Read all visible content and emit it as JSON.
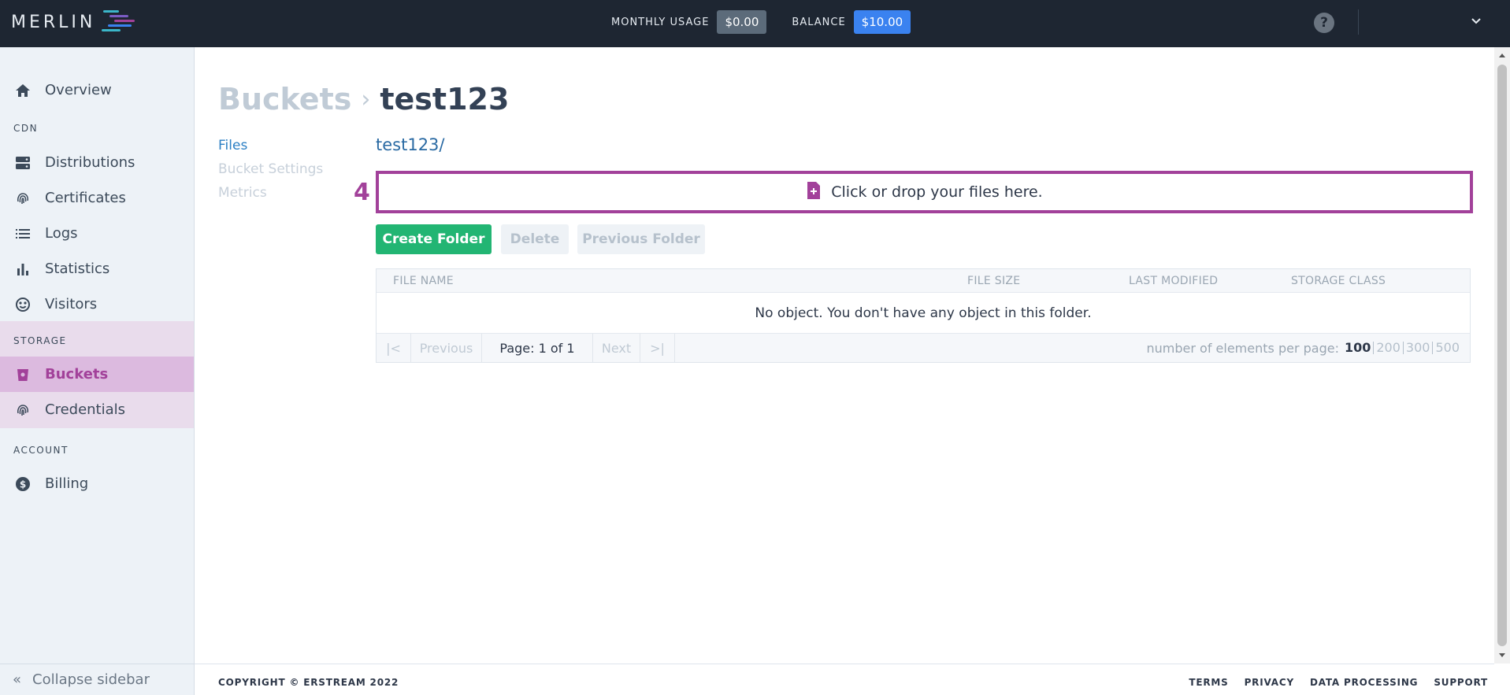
{
  "header": {
    "logo_text": "MERLIN",
    "monthly_usage_label": "MONTHLY USAGE",
    "monthly_usage_value": "$0.00",
    "balance_label": "BALANCE",
    "balance_value": "$10.00",
    "help_icon": "question-circle-icon",
    "menu_icon": "chevron-down-icon",
    "colors": {
      "bar": "#1e2632",
      "balance": "#3a82f0",
      "usage": "#5c6b7a"
    }
  },
  "sidebar": {
    "overview": "Overview",
    "cdn_heading": "CDN",
    "distributions": "Distributions",
    "certificates": "Certificates",
    "logs": "Logs",
    "statistics": "Statistics",
    "visitors": "Visitors",
    "storage_heading": "STORAGE",
    "buckets": "Buckets",
    "credentials": "Credentials",
    "account_heading": "ACCOUNT",
    "billing": "Billing",
    "collapse": "Collapse sidebar",
    "active_color": "#a2419a"
  },
  "page": {
    "breadcrumb_root": "Buckets",
    "breadcrumb_sep": "›",
    "title": "test123",
    "subnav": {
      "files": "Files",
      "bucket_settings": "Bucket Settings",
      "metrics": "Metrics"
    },
    "path": "test123/",
    "annotation_number": "4",
    "dropzone_text": "Click or drop your files here.",
    "buttons": {
      "create_folder": "Create Folder",
      "delete": "Delete",
      "previous_folder": "Previous Folder"
    },
    "table": {
      "columns": [
        "FILE NAME",
        "FILE SIZE",
        "LAST MODIFIED",
        "STORAGE CLASS"
      ],
      "empty_message": "No object. You don't have any object in this folder."
    },
    "pager": {
      "first": "|<",
      "previous": "Previous",
      "page_label": "Page: 1 of 1",
      "next": "Next",
      "last": ">|",
      "per_page_label": "number of elements per page:",
      "per_page_options": [
        "100",
        "200",
        "300",
        "500"
      ]
    }
  },
  "footer": {
    "copyright": "COPYRIGHT © ERSTREAM 2022",
    "links": [
      "TERMS",
      "PRIVACY",
      "DATA PROCESSING",
      "SUPPORT"
    ]
  }
}
